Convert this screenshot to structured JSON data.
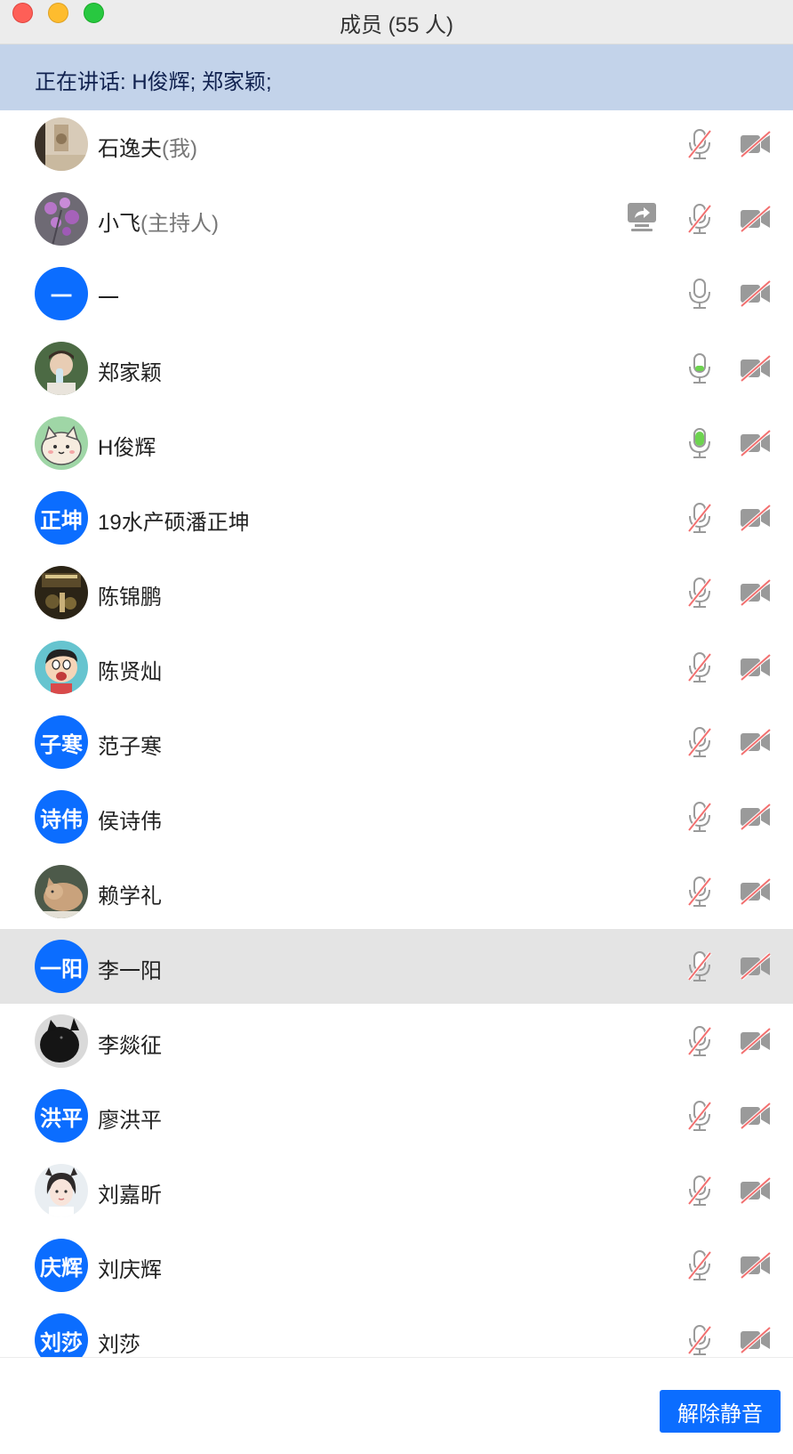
{
  "window": {
    "title": "成员 (55 人)"
  },
  "speaking": {
    "text": "正在讲话: H俊辉; 郑家颖;"
  },
  "colors": {
    "accent": "#0b6dff",
    "banner": "#c3d3ea",
    "mic_active": "#6dd34f",
    "muted_slash": "#f27070",
    "icon_gray": "#9a9a9a"
  },
  "members": [
    {
      "name": "石逸夫",
      "tag": "(我)",
      "avatar": {
        "type": "photo",
        "icon": "photo-avatar-sand"
      },
      "mic": "muted",
      "cam": "off",
      "share": false
    },
    {
      "name": "小飞",
      "tag": "(主持人)",
      "avatar": {
        "type": "photo",
        "icon": "photo-avatar-flowers"
      },
      "mic": "muted",
      "cam": "off",
      "share": true
    },
    {
      "name": "一",
      "tag": "",
      "avatar": {
        "type": "text",
        "text": "一"
      },
      "mic": "on",
      "cam": "off",
      "share": false
    },
    {
      "name": "郑家颖",
      "tag": "",
      "avatar": {
        "type": "photo",
        "icon": "photo-avatar-person-drinking"
      },
      "mic": "speaking-low",
      "cam": "off",
      "share": false
    },
    {
      "name": "H俊辉",
      "tag": "",
      "avatar": {
        "type": "photo",
        "icon": "photo-avatar-cartoon-cat"
      },
      "mic": "speaking-high",
      "cam": "off",
      "share": false
    },
    {
      "name": "19水产硕潘正坤",
      "tag": "",
      "avatar": {
        "type": "text",
        "text": "正坤"
      },
      "mic": "muted",
      "cam": "off",
      "share": false
    },
    {
      "name": "陈锦鹏",
      "tag": "",
      "avatar": {
        "type": "photo",
        "icon": "photo-avatar-night-scene"
      },
      "mic": "muted",
      "cam": "off",
      "share": false
    },
    {
      "name": "陈贤灿",
      "tag": "",
      "avatar": {
        "type": "photo",
        "icon": "photo-avatar-cartoon-boy"
      },
      "mic": "muted",
      "cam": "off",
      "share": false
    },
    {
      "name": "范子寒",
      "tag": "",
      "avatar": {
        "type": "text",
        "text": "子寒"
      },
      "mic": "muted",
      "cam": "off",
      "share": false
    },
    {
      "name": "侯诗伟",
      "tag": "",
      "avatar": {
        "type": "text",
        "text": "诗伟"
      },
      "mic": "muted",
      "cam": "off",
      "share": false
    },
    {
      "name": "赖学礼",
      "tag": "",
      "avatar": {
        "type": "photo",
        "icon": "photo-avatar-cat"
      },
      "mic": "muted",
      "cam": "off",
      "share": false
    },
    {
      "name": "李一阳",
      "tag": "",
      "avatar": {
        "type": "text",
        "text": "一阳"
      },
      "mic": "muted",
      "cam": "off",
      "share": false,
      "highlight": true
    },
    {
      "name": "李燚征",
      "tag": "",
      "avatar": {
        "type": "photo",
        "icon": "photo-avatar-black-cat"
      },
      "mic": "muted",
      "cam": "off",
      "share": false
    },
    {
      "name": "廖洪平",
      "tag": "",
      "avatar": {
        "type": "text",
        "text": "洪平"
      },
      "mic": "muted",
      "cam": "off",
      "share": false
    },
    {
      "name": "刘嘉昕",
      "tag": "",
      "avatar": {
        "type": "photo",
        "icon": "photo-avatar-girl"
      },
      "mic": "muted",
      "cam": "off",
      "share": false
    },
    {
      "name": "刘庆辉",
      "tag": "",
      "avatar": {
        "type": "text",
        "text": "庆辉"
      },
      "mic": "muted",
      "cam": "off",
      "share": false
    },
    {
      "name": "刘莎",
      "tag": "",
      "avatar": {
        "type": "text",
        "text": "刘莎"
      },
      "mic": "muted",
      "cam": "off",
      "share": false
    }
  ],
  "footer": {
    "unmute_label": "解除静音"
  }
}
